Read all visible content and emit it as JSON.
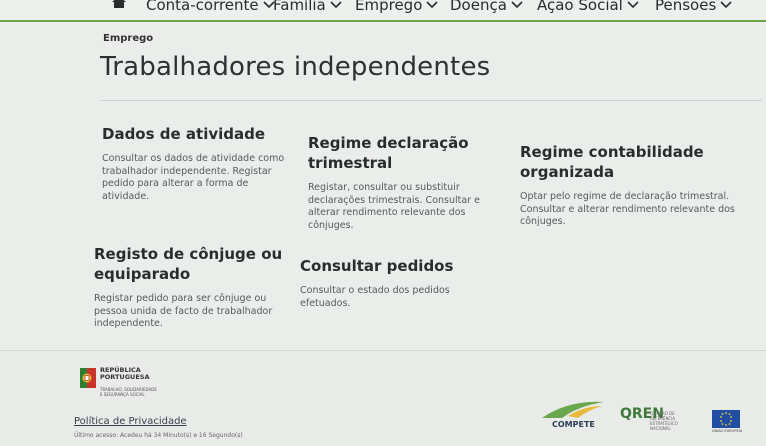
{
  "nav": {
    "items": [
      {
        "label": "Conta-corrente"
      },
      {
        "label": "Família"
      },
      {
        "label": "Emprego"
      },
      {
        "label": "Doença"
      },
      {
        "label": "Ação Social"
      },
      {
        "label": "Pensões"
      }
    ]
  },
  "page": {
    "section": "Emprego",
    "title": "Trabalhadores independentes"
  },
  "cards": [
    {
      "title": "Dados de atividade",
      "desc": "Consultar os dados de atividade como trabalhador independente. Registar pedido para alterar a forma de atividade."
    },
    {
      "title": "Regime declaração trimestral",
      "desc": "Registar, consultar ou substituir declarações trimestrais. Consultar e alterar rendimento relevante dos cônjuges."
    },
    {
      "title": "Regime contabilidade organizada",
      "desc": "Optar pelo regime de declaração trimestral. Consultar e alterar rendimento relevante dos cônjuges."
    },
    {
      "title": "Registo de cônjuge ou equiparado",
      "desc": "Registar pedido para ser cônjuge ou pessoa unida de facto de trabalhador independente."
    },
    {
      "title": "Consultar pedidos",
      "desc": "Consultar o estado dos pedidos efetuados."
    }
  ],
  "footer": {
    "rp_line1": "REPÚBLICA",
    "rp_line2": "PORTUGUESA",
    "rp_sub": "TRABALHO, SOLIDARIEDADE E SEGURANÇA SOCIAL",
    "privacy": "Política de Privacidade",
    "small": "Último acesso: Acedeu há 34 Minuto(s) e 16 Segundo(s)",
    "compete": "COMPETE",
    "norte_letters": "QREN",
    "norte_text": "QUADRO DE REFERÊNCIA ESTRATÉGICO NACIONAL",
    "eu_text": "UNIÃO EUROPEIA"
  },
  "colors": {
    "accent_green": "#6aa84f",
    "text_dark": "#2a2d2e",
    "background": "#ebedeb"
  }
}
